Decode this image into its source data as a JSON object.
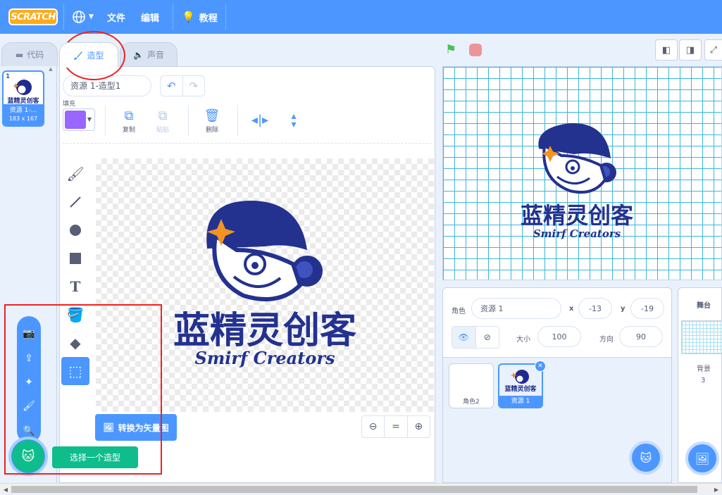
{
  "menubar": {
    "logo": "SCRATCH",
    "file": "文件",
    "edit": "编辑",
    "tutorials": "教程"
  },
  "tabs": [
    {
      "label": "代码",
      "icon": "code-icon"
    },
    {
      "label": "造型",
      "icon": "brush-icon"
    },
    {
      "label": "声音",
      "icon": "speaker-icon"
    }
  ],
  "costume_list": [
    {
      "index": "1",
      "name": "资源 1-...",
      "size": "183 x 167"
    }
  ],
  "editor": {
    "costume_name": "资源 1-造型1",
    "fill_label": "填充",
    "fill_color": "#9966ff",
    "copy": "复制",
    "paste": "粘贴",
    "delete": "删除",
    "convert_button": "转换为矢量图",
    "zoom_reset": "="
  },
  "logo_art": {
    "chinese": "蓝精灵创客",
    "english": "Smirf Creators"
  },
  "costume_menu_tooltip": "选择一个造型",
  "sprite_info": {
    "sprite_label": "角色",
    "sprite_name": "资源 1",
    "x_label": "x",
    "x_value": "-13",
    "y_label": "y",
    "y_value": "-19",
    "size_label": "大小",
    "size_value": "100",
    "direction_label": "方向",
    "direction_value": "90"
  },
  "sprites": [
    {
      "name": "角色2"
    },
    {
      "name": "资源 1"
    }
  ],
  "stage_panel": {
    "title": "舞台",
    "backdrops_label": "背景",
    "backdrops_count": "3"
  },
  "colors": {
    "accent": "#4c97ff",
    "extension": "#0fbd8c",
    "highlight": "#ee2222"
  }
}
